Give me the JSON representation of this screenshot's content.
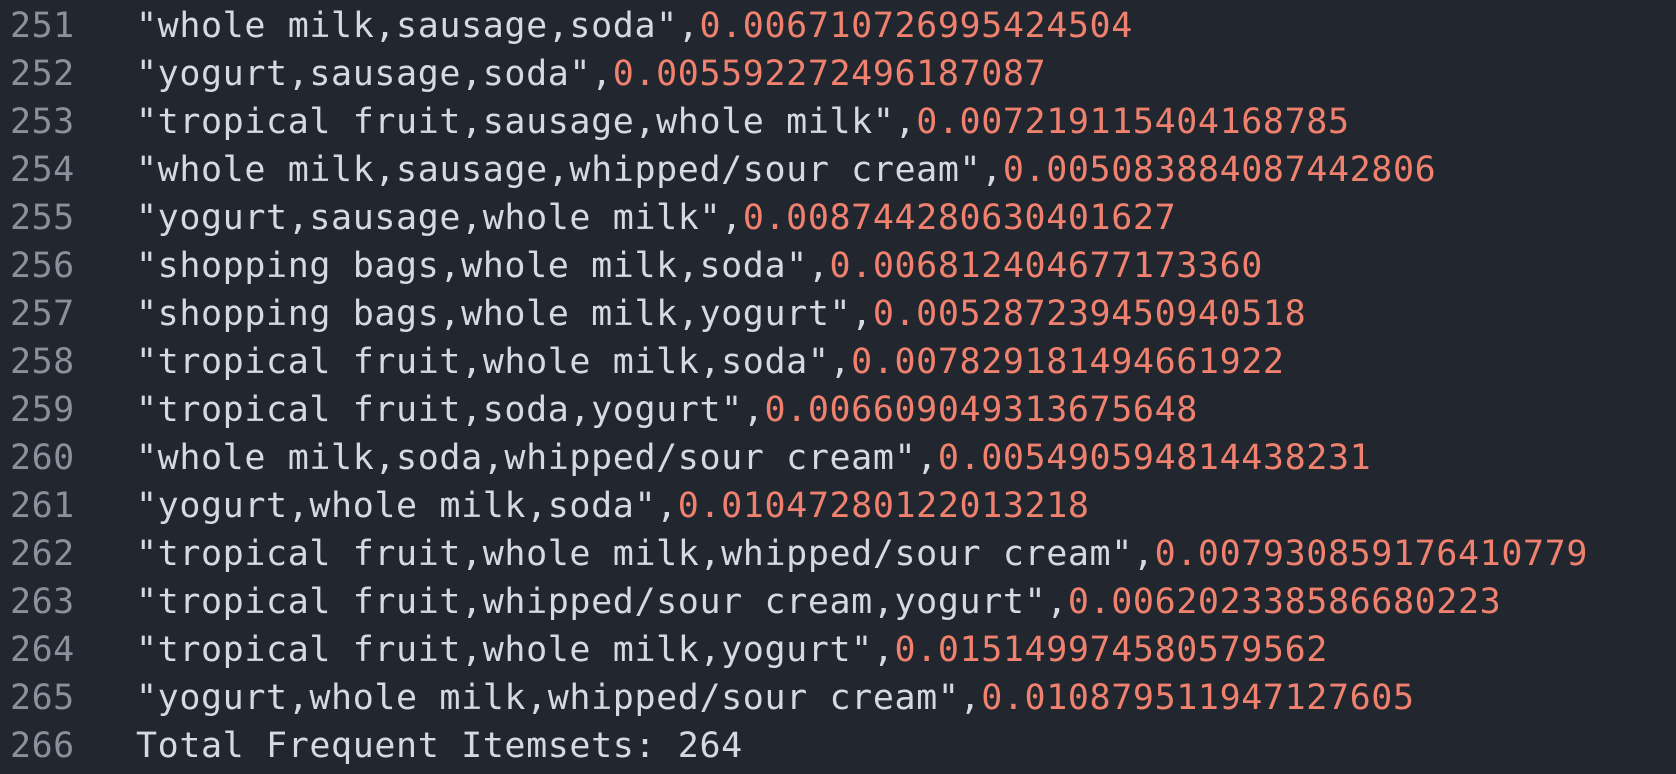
{
  "colors": {
    "background": "#22262e",
    "line_number": "#8a919c",
    "text": "#d6dae0",
    "number": "#f0816e"
  },
  "lines": [
    {
      "number": "251",
      "string": "\"whole milk,sausage,soda\"",
      "sep": ",",
      "value": "0.006710726995424504"
    },
    {
      "number": "252",
      "string": "\"yogurt,sausage,soda\"",
      "sep": ",",
      "value": "0.005592272496187087"
    },
    {
      "number": "253",
      "string": "\"tropical fruit,sausage,whole milk\"",
      "sep": ",",
      "value": "0.007219115404168785"
    },
    {
      "number": "254",
      "string": "\"whole milk,sausage,whipped/sour cream\"",
      "sep": ",",
      "value": "0.005083884087442806"
    },
    {
      "number": "255",
      "string": "\"yogurt,sausage,whole milk\"",
      "sep": ",",
      "value": "0.008744280630401627"
    },
    {
      "number": "256",
      "string": "\"shopping bags,whole milk,soda\"",
      "sep": ",",
      "value": "0.006812404677173360"
    },
    {
      "number": "257",
      "string": "\"shopping bags,whole milk,yogurt\"",
      "sep": ",",
      "value": "0.005287239450940518"
    },
    {
      "number": "258",
      "string": "\"tropical fruit,whole milk,soda\"",
      "sep": ",",
      "value": "0.007829181494661922"
    },
    {
      "number": "259",
      "string": "\"tropical fruit,soda,yogurt\"",
      "sep": ",",
      "value": "0.006609049313675648"
    },
    {
      "number": "260",
      "string": "\"whole milk,soda,whipped/sour cream\"",
      "sep": ",",
      "value": "0.005490594814438231"
    },
    {
      "number": "261",
      "string": "\"yogurt,whole milk,soda\"",
      "sep": ",",
      "value": "0.01047280122013218"
    },
    {
      "number": "262",
      "string": "\"tropical fruit,whole milk,whipped/sour cream\"",
      "sep": ",",
      "value": "0.007930859176410779"
    },
    {
      "number": "263",
      "string": "\"tropical fruit,whipped/sour cream,yogurt\"",
      "sep": ",",
      "value": "0.006202338586680223"
    },
    {
      "number": "264",
      "string": "\"tropical fruit,whole milk,yogurt\"",
      "sep": ",",
      "value": "0.015149974580579562"
    },
    {
      "number": "265",
      "string": "\"yogurt,whole milk,whipped/sour cream\"",
      "sep": ",",
      "value": "0.010879511947127605"
    }
  ],
  "footer_line": {
    "number": "266",
    "text": "Total Frequent Itemsets: 264"
  }
}
